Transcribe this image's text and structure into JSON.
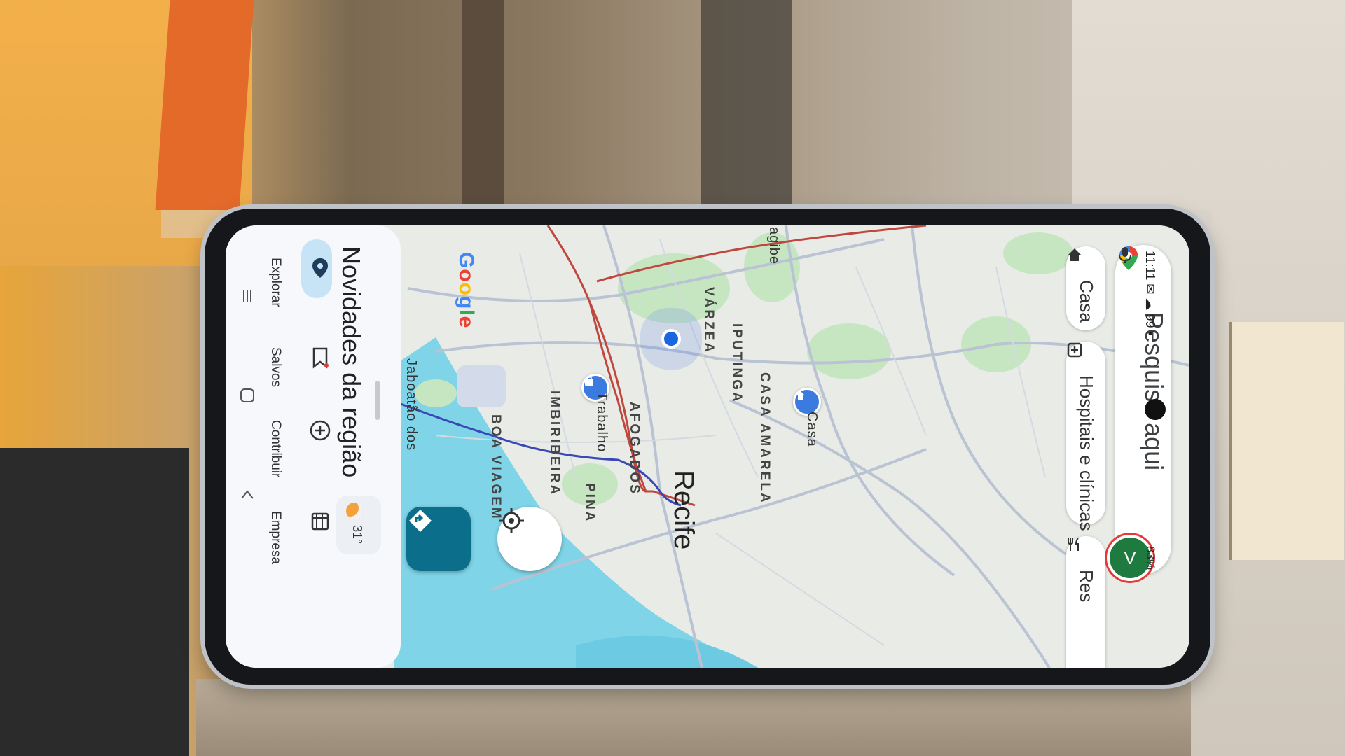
{
  "status_bar": {
    "time": "11:11",
    "left_icons": "✉ ☁ 99 •",
    "battery": "83%"
  },
  "search": {
    "placeholder": "Pesquise aqui"
  },
  "chips": [
    {
      "label": "Casa",
      "icon": "home-icon"
    },
    {
      "label": "Hospitais e clínicas",
      "icon": "hospital-icon"
    },
    {
      "label": "Res",
      "icon": "restaurant-icon"
    }
  ],
  "avatar": {
    "initial": "V"
  },
  "map": {
    "labels": [
      {
        "text": "VÁRZEA"
      },
      {
        "text": "IPUTINGA"
      },
      {
        "text": "CASA AMARELA"
      },
      {
        "text": "AFOGADOS"
      },
      {
        "text": "IMBIRIBEIRA"
      },
      {
        "text": "BOA VIAGEM"
      },
      {
        "text": "PINA"
      },
      {
        "text": "Jaboatão dos"
      },
      {
        "text": "agibe"
      }
    ],
    "city": "Recife",
    "pins": [
      {
        "label": "Trabalho",
        "icon": "work-icon"
      },
      {
        "label": "Casa",
        "icon": "home-icon"
      }
    ],
    "google_logo": [
      "G",
      "o",
      "o",
      "g",
      "l",
      "e"
    ]
  },
  "sheet": {
    "title": "Novidades da região",
    "weather_temp": "31°"
  },
  "bottom_nav": [
    {
      "label": "Explorar",
      "icon": "explore-pin-icon",
      "active": true
    },
    {
      "label": "Salvos",
      "icon": "bookmark-icon",
      "active": false
    },
    {
      "label": "Contribuir",
      "icon": "add-circle-icon",
      "active": false
    },
    {
      "label": "Empresa",
      "icon": "store-icon",
      "active": false
    }
  ]
}
